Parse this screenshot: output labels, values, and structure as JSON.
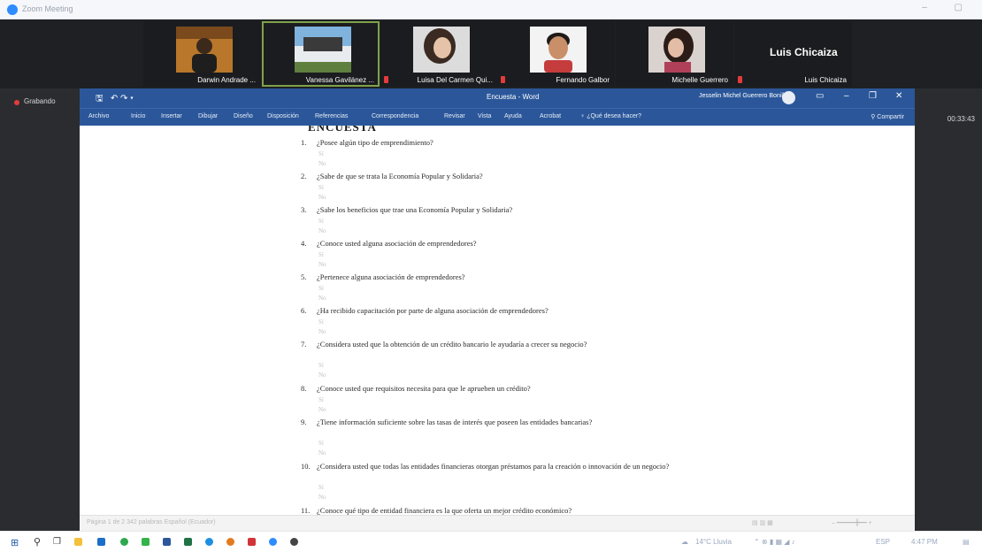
{
  "app": {
    "title": "Zoom Meeting"
  },
  "meeting": {
    "participants": [
      {
        "name": "Darwin Andrade ..."
      },
      {
        "name": "Vanessa Gavilánez ..."
      },
      {
        "name": "Luisa Del Carmen Qui..."
      },
      {
        "name": "Fernando Galbor"
      },
      {
        "name": "Michelle Guerrero"
      },
      {
        "name": "Luis Chicaiza"
      }
    ],
    "big_name": "Luis Chicaiza",
    "recording_label": "Grabando",
    "timer": "00:33:43"
  },
  "word": {
    "doc_title": "Encuesta - Word",
    "user": "Jesselin Michel Guerrero Bonilla",
    "ribbon_tabs": [
      "Archivo",
      "Inicio",
      "Insertar",
      "Dibujar",
      "Diseño",
      "Disposición",
      "Referencias",
      "Correspondencia",
      "Revisar",
      "Vista",
      "Ayuda",
      "Acrobat",
      "¿Qué desea hacer?"
    ],
    "share": "Compartir",
    "heading": "ENCUESTA",
    "questions": [
      {
        "num": "1.",
        "text": "¿Posee algún tipo de emprendimiento?"
      },
      {
        "num": "2.",
        "text": "¿Sabe de que se trata la Economía Popular y Solidaria?"
      },
      {
        "num": "3.",
        "text": "¿Sabe los beneficios que trae una Economía Popular y Solidaria?"
      },
      {
        "num": "4.",
        "text": "¿Conoce usted alguna asociación de emprendedores?"
      },
      {
        "num": "5.",
        "text": "¿Pertenece alguna asociación de emprendedores?"
      },
      {
        "num": "6.",
        "text": "¿Ha recibido capacitación por parte de alguna asociación de emprendedores?"
      },
      {
        "num": "7.",
        "text": "¿Considera usted que la obtención de un crédito bancario le ayudaría a crecer su negocio?"
      },
      {
        "num": "8.",
        "text": "¿Conoce usted que requisitos necesita para que le aprueben un crédito?"
      },
      {
        "num": "9.",
        "text": "¿Tiene información suficiente sobre las tasas de interés que poseen las entidades bancarias?"
      },
      {
        "num": "10.",
        "text": "¿Considera usted que todas las entidades financieras otorgan préstamos para la creación o innovación de un negocio?"
      },
      {
        "num": "11.",
        "text": "¿Conoce qué tipo de entidad financiera es la que oferta un mejor crédito económico?"
      }
    ],
    "option_yes": "Sí",
    "option_no": "No",
    "status_left": "Página 1 de 2   342 palabras   Español (Ecuador)"
  },
  "taskbar": {
    "weather": "14°C Lluvia",
    "lang": "ESP",
    "time": "4:47 PM"
  }
}
